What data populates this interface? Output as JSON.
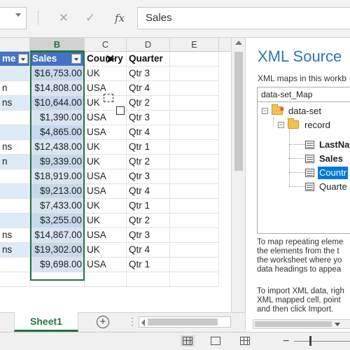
{
  "formula_bar": {
    "cancel_icon": "close-icon",
    "enter_icon": "check-icon",
    "function_label": "fx",
    "value": "Sales"
  },
  "sheet": {
    "columns": [
      "B",
      "C",
      "D",
      "E"
    ],
    "selected_column": "B",
    "header_row": {
      "name_fragment": "me",
      "sales": "Sales",
      "country": "Country",
      "quarter": "Quarter"
    },
    "rows": [
      {
        "name": "",
        "sales": "$16,753.00",
        "country": "UK",
        "quarter": "Qtr 3"
      },
      {
        "name": "n",
        "sales": "$14,808.00",
        "country": "USA",
        "quarter": "Qtr 4"
      },
      {
        "name": "ns",
        "sales": "$10,644.00",
        "country": "UK",
        "quarter": "Qtr 2"
      },
      {
        "name": "",
        "sales": "$1,390.00",
        "country": "USA",
        "quarter": "Qtr 3"
      },
      {
        "name": "",
        "sales": "$4,865.00",
        "country": "USA",
        "quarter": "Qtr 4"
      },
      {
        "name": "ns",
        "sales": "$12,438.00",
        "country": "UK",
        "quarter": "Qtr 1"
      },
      {
        "name": "n",
        "sales": "$9,339.00",
        "country": "UK",
        "quarter": "Qtr 2"
      },
      {
        "name": "",
        "sales": "$18,919.00",
        "country": "USA",
        "quarter": "Qtr 3"
      },
      {
        "name": "",
        "sales": "$9,213.00",
        "country": "USA",
        "quarter": "Qtr 4"
      },
      {
        "name": "",
        "sales": "$7,433.00",
        "country": "UK",
        "quarter": "Qtr 1"
      },
      {
        "name": "",
        "sales": "$3,255.00",
        "country": "UK",
        "quarter": "Qtr 2"
      },
      {
        "name": "ns",
        "sales": "$14,867.00",
        "country": "USA",
        "quarter": "Qtr 3"
      },
      {
        "name": "ns",
        "sales": "$19,302.00",
        "country": "UK",
        "quarter": "Qtr 4"
      },
      {
        "name": "",
        "sales": "$9,698.00",
        "country": "USA",
        "quarter": "Qtr 1"
      }
    ],
    "sheet_tab": "Sheet1",
    "add_sheet_icon": "plus-circle-icon"
  },
  "xml_pane": {
    "title": "XML Source",
    "maps_label": "XML maps in this workb",
    "selected_map": "data-set_Map",
    "tree": {
      "root": "data-set",
      "record": "record",
      "fields": [
        "LastNar",
        "Sales",
        "Countr",
        "Quarte"
      ],
      "selected_field": "Countr"
    },
    "help_text_1": [
      "To map repeating eleme",
      "the elements from the t",
      "the worksheet where yo",
      "data headings to appea"
    ],
    "help_text_2": [
      "To import XML data, righ",
      "XML mapped cell, point",
      "and then click Import."
    ]
  },
  "colors": {
    "excel_green": "#217346",
    "table_header": "#4472c4",
    "band": "#ddebf7",
    "pane_title": "#2e75b6",
    "selection": "#0078d7"
  }
}
